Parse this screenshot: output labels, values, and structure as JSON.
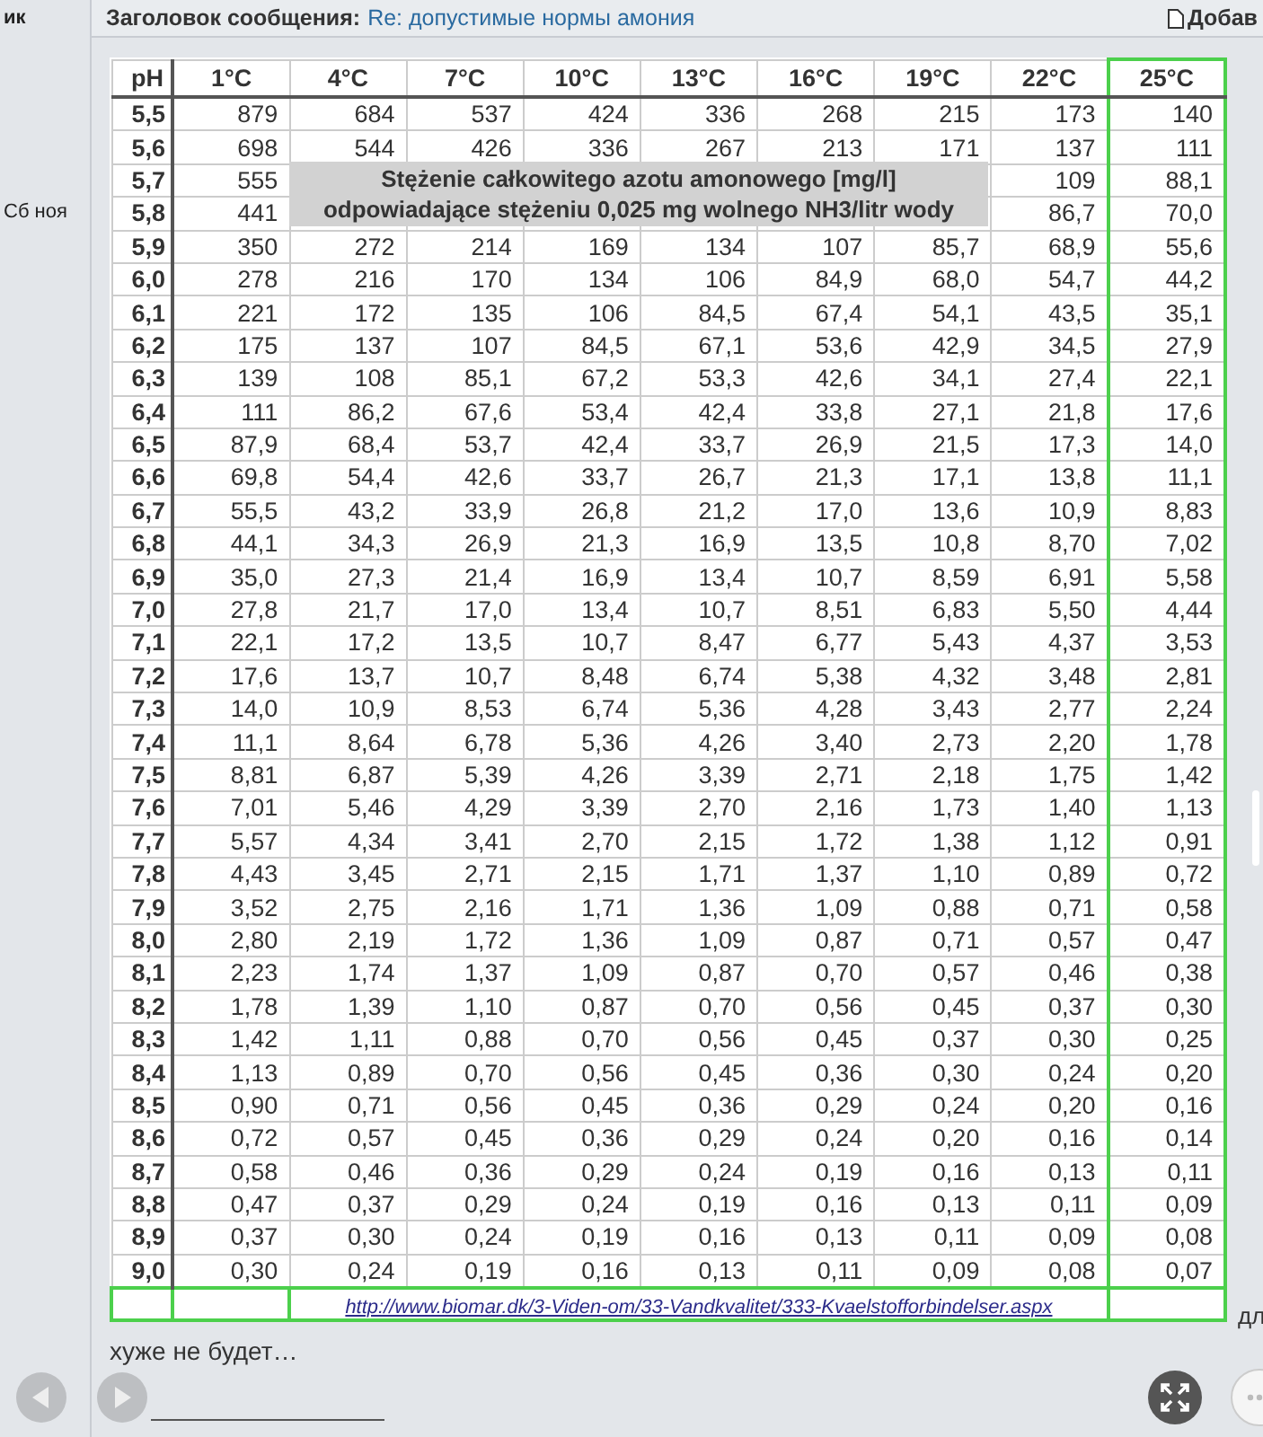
{
  "sidebar": {
    "texts": [
      "ик",
      "Сб ноя"
    ]
  },
  "header": {
    "label": "Заголовок сообщения:",
    "subject": "Re: допустимые нормы амония",
    "action": "Добав"
  },
  "table": {
    "columns": [
      "pH",
      "1°C",
      "4°C",
      "7°C",
      "10°C",
      "13°C",
      "16°C",
      "19°C",
      "22°C",
      "25°C"
    ],
    "rows": [
      {
        "ph": "5,5",
        "values": [
          "879",
          "684",
          "537",
          "424",
          "336",
          "268",
          "215",
          "173",
          "140"
        ]
      },
      {
        "ph": "5,6",
        "values": [
          "698",
          "544",
          "426",
          "336",
          "267",
          "213",
          "171",
          "137",
          "111"
        ]
      },
      {
        "ph": "5,7",
        "kind": "under-caption",
        "values": [
          "555",
          "109",
          "88,1"
        ]
      },
      {
        "ph": "5,8",
        "kind": "under-caption",
        "values": [
          "441",
          "86,7",
          "70,0"
        ]
      },
      {
        "ph": "5,9",
        "values": [
          "350",
          "272",
          "214",
          "169",
          "134",
          "107",
          "85,7",
          "68,9",
          "55,6"
        ]
      },
      {
        "ph": "6,0",
        "values": [
          "278",
          "216",
          "170",
          "134",
          "106",
          "84,9",
          "68,0",
          "54,7",
          "44,2"
        ]
      },
      {
        "ph": "6,1",
        "values": [
          "221",
          "172",
          "135",
          "106",
          "84,5",
          "67,4",
          "54,1",
          "43,5",
          "35,1"
        ]
      },
      {
        "ph": "6,2",
        "values": [
          "175",
          "137",
          "107",
          "84,5",
          "67,1",
          "53,6",
          "42,9",
          "34,5",
          "27,9"
        ]
      },
      {
        "ph": "6,3",
        "values": [
          "139",
          "108",
          "85,1",
          "67,2",
          "53,3",
          "42,6",
          "34,1",
          "27,4",
          "22,1"
        ]
      },
      {
        "ph": "6,4",
        "values": [
          "111",
          "86,2",
          "67,6",
          "53,4",
          "42,4",
          "33,8",
          "27,1",
          "21,8",
          "17,6"
        ]
      },
      {
        "ph": "6,5",
        "values": [
          "87,9",
          "68,4",
          "53,7",
          "42,4",
          "33,7",
          "26,9",
          "21,5",
          "17,3",
          "14,0"
        ]
      },
      {
        "ph": "6,6",
        "values": [
          "69,8",
          "54,4",
          "42,6",
          "33,7",
          "26,7",
          "21,3",
          "17,1",
          "13,8",
          "11,1"
        ]
      },
      {
        "ph": "6,7",
        "values": [
          "55,5",
          "43,2",
          "33,9",
          "26,8",
          "21,2",
          "17,0",
          "13,6",
          "10,9",
          "8,83"
        ]
      },
      {
        "ph": "6,8",
        "values": [
          "44,1",
          "34,3",
          "26,9",
          "21,3",
          "16,9",
          "13,5",
          "10,8",
          "8,70",
          "7,02"
        ]
      },
      {
        "ph": "6,9",
        "values": [
          "35,0",
          "27,3",
          "21,4",
          "16,9",
          "13,4",
          "10,7",
          "8,59",
          "6,91",
          "5,58"
        ]
      },
      {
        "ph": "7,0",
        "values": [
          "27,8",
          "21,7",
          "17,0",
          "13,4",
          "10,7",
          "8,51",
          "6,83",
          "5,50",
          "4,44"
        ]
      },
      {
        "ph": "7,1",
        "values": [
          "22,1",
          "17,2",
          "13,5",
          "10,7",
          "8,47",
          "6,77",
          "5,43",
          "4,37",
          "3,53"
        ]
      },
      {
        "ph": "7,2",
        "values": [
          "17,6",
          "13,7",
          "10,7",
          "8,48",
          "6,74",
          "5,38",
          "4,32",
          "3,48",
          "2,81"
        ]
      },
      {
        "ph": "7,3",
        "values": [
          "14,0",
          "10,9",
          "8,53",
          "6,74",
          "5,36",
          "4,28",
          "3,43",
          "2,77",
          "2,24"
        ]
      },
      {
        "ph": "7,4",
        "values": [
          "11,1",
          "8,64",
          "6,78",
          "5,36",
          "4,26",
          "3,40",
          "2,73",
          "2,20",
          "1,78"
        ]
      },
      {
        "ph": "7,5",
        "values": [
          "8,81",
          "6,87",
          "5,39",
          "4,26",
          "3,39",
          "2,71",
          "2,18",
          "1,75",
          "1,42"
        ]
      },
      {
        "ph": "7,6",
        "values": [
          "7,01",
          "5,46",
          "4,29",
          "3,39",
          "2,70",
          "2,16",
          "1,73",
          "1,40",
          "1,13"
        ]
      },
      {
        "ph": "7,7",
        "values": [
          "5,57",
          "4,34",
          "3,41",
          "2,70",
          "2,15",
          "1,72",
          "1,38",
          "1,12",
          "0,91"
        ]
      },
      {
        "ph": "7,8",
        "values": [
          "4,43",
          "3,45",
          "2,71",
          "2,15",
          "1,71",
          "1,37",
          "1,10",
          "0,89",
          "0,72"
        ]
      },
      {
        "ph": "7,9",
        "values": [
          "3,52",
          "2,75",
          "2,16",
          "1,71",
          "1,36",
          "1,09",
          "0,88",
          "0,71",
          "0,58"
        ]
      },
      {
        "ph": "8,0",
        "values": [
          "2,80",
          "2,19",
          "1,72",
          "1,36",
          "1,09",
          "0,87",
          "0,71",
          "0,57",
          "0,47"
        ]
      },
      {
        "ph": "8,1",
        "values": [
          "2,23",
          "1,74",
          "1,37",
          "1,09",
          "0,87",
          "0,70",
          "0,57",
          "0,46",
          "0,38"
        ]
      },
      {
        "ph": "8,2",
        "values": [
          "1,78",
          "1,39",
          "1,10",
          "0,87",
          "0,70",
          "0,56",
          "0,45",
          "0,37",
          "0,30"
        ]
      },
      {
        "ph": "8,3",
        "values": [
          "1,42",
          "1,11",
          "0,88",
          "0,70",
          "0,56",
          "0,45",
          "0,37",
          "0,30",
          "0,25"
        ]
      },
      {
        "ph": "8,4",
        "values": [
          "1,13",
          "0,89",
          "0,70",
          "0,56",
          "0,45",
          "0,36",
          "0,30",
          "0,24",
          "0,20"
        ]
      },
      {
        "ph": "8,5",
        "values": [
          "0,90",
          "0,71",
          "0,56",
          "0,45",
          "0,36",
          "0,29",
          "0,24",
          "0,20",
          "0,16"
        ]
      },
      {
        "ph": "8,6",
        "values": [
          "0,72",
          "0,57",
          "0,45",
          "0,36",
          "0,29",
          "0,24",
          "0,20",
          "0,16",
          "0,14"
        ]
      },
      {
        "ph": "8,7",
        "values": [
          "0,58",
          "0,46",
          "0,36",
          "0,29",
          "0,24",
          "0,19",
          "0,16",
          "0,13",
          "0,11"
        ]
      },
      {
        "ph": "8,8",
        "values": [
          "0,47",
          "0,37",
          "0,29",
          "0,24",
          "0,19",
          "0,16",
          "0,13",
          "0,11",
          "0,09"
        ]
      },
      {
        "ph": "8,9",
        "values": [
          "0,37",
          "0,30",
          "0,24",
          "0,19",
          "0,16",
          "0,13",
          "0,11",
          "0,09",
          "0,08"
        ]
      },
      {
        "ph": "9,0",
        "values": [
          "0,30",
          "0,24",
          "0,19",
          "0,16",
          "0,13",
          "0,11",
          "0,09",
          "0,08",
          "0,07"
        ]
      }
    ],
    "source_link": "http://www.biomar.dk/3-Viden-om/33-Vandkvalitet/333-Kvaelstofforbindelser.aspx",
    "overlay": [
      "Stężenie całkowitego azotu amonowego [mg/l]",
      "odpowiadające stężeniu 0,025 mg wolnego NH3/litr wody"
    ]
  },
  "side_text": "дл",
  "message_text": "хуже не будет…"
}
